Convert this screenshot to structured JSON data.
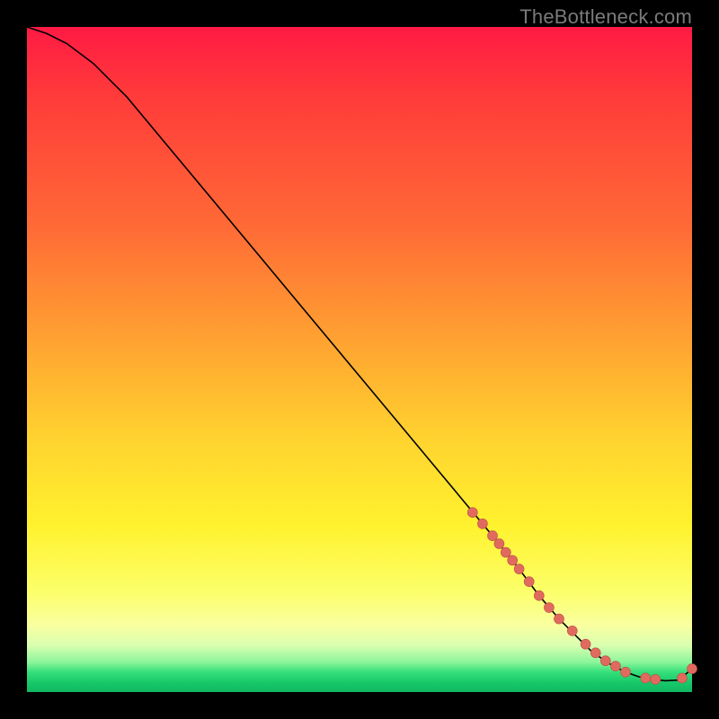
{
  "watermark": "TheBottleneck.com",
  "colors": {
    "marker_fill": "#e16a5f",
    "marker_stroke": "#bb4f45",
    "curve_stroke": "#000000"
  },
  "chart_data": {
    "type": "line",
    "title": "",
    "xlabel": "",
    "ylabel": "",
    "xlim": [
      0,
      100
    ],
    "ylim": [
      0,
      100
    ],
    "series": [
      {
        "name": "curve",
        "x": [
          0,
          3,
          6,
          10,
          15,
          20,
          25,
          30,
          35,
          40,
          45,
          50,
          55,
          60,
          65,
          70,
          74,
          77,
          80,
          83,
          85,
          88,
          90,
          92,
          94,
          96,
          98,
          100
        ],
        "y": [
          100,
          99,
          97.5,
          94.5,
          89.5,
          83.5,
          77.5,
          71.5,
          65.5,
          59.5,
          53.5,
          47.5,
          41.5,
          35.5,
          29.5,
          23.5,
          18.5,
          14.5,
          11,
          8,
          6,
          4,
          3,
          2.3,
          1.9,
          1.7,
          1.8,
          3.5
        ]
      }
    ],
    "markers": {
      "name": "highlighted-points",
      "x": [
        67,
        68.5,
        70,
        71,
        72,
        73,
        74,
        75.5,
        77,
        78.5,
        80,
        82,
        84,
        85.5,
        87,
        88.5,
        90,
        93,
        94.5,
        98.5,
        100
      ],
      "y": [
        27,
        25.3,
        23.5,
        22.3,
        21,
        19.8,
        18.5,
        16.6,
        14.5,
        12.7,
        11,
        9.2,
        7.2,
        5.9,
        4.7,
        3.9,
        3,
        2.1,
        1.9,
        2.1,
        3.5
      ],
      "radius": 5.5
    }
  }
}
